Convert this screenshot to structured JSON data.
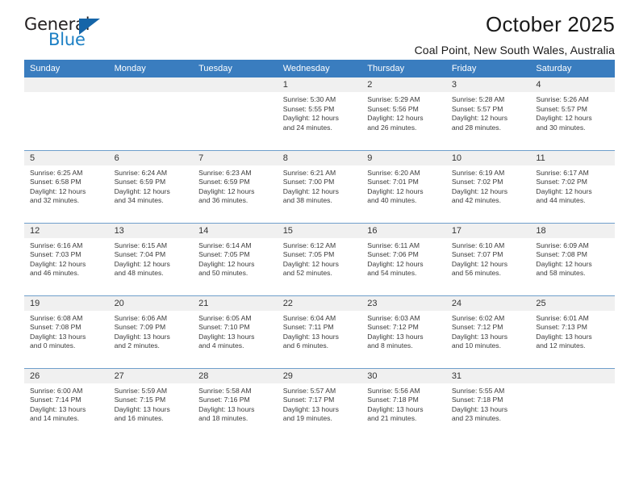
{
  "brand": {
    "word_one": "General",
    "word_two": "Blue",
    "triangle_color": "#1565a8",
    "blue_color": "#1b7fc4"
  },
  "header": {
    "month_title": "October 2025",
    "location": "Coal Point, New South Wales, Australia",
    "header_bg": "#3a7dbf"
  },
  "weekday_headers": [
    "Sunday",
    "Monday",
    "Tuesday",
    "Wednesday",
    "Thursday",
    "Friday",
    "Saturday"
  ],
  "labels": {
    "sunrise_prefix": "Sunrise:",
    "sunset_prefix": "Sunset:",
    "daylight_prefix": "Daylight:"
  },
  "weeks": [
    [
      {
        "day": "",
        "empty": true
      },
      {
        "day": "",
        "empty": true
      },
      {
        "day": "",
        "empty": true
      },
      {
        "day": "1",
        "sunrise": "Sunrise: 5:30 AM",
        "sunset": "Sunset: 5:55 PM",
        "daylight_1": "Daylight: 12 hours",
        "daylight_2": "and 24 minutes."
      },
      {
        "day": "2",
        "sunrise": "Sunrise: 5:29 AM",
        "sunset": "Sunset: 5:56 PM",
        "daylight_1": "Daylight: 12 hours",
        "daylight_2": "and 26 minutes."
      },
      {
        "day": "3",
        "sunrise": "Sunrise: 5:28 AM",
        "sunset": "Sunset: 5:57 PM",
        "daylight_1": "Daylight: 12 hours",
        "daylight_2": "and 28 minutes."
      },
      {
        "day": "4",
        "sunrise": "Sunrise: 5:26 AM",
        "sunset": "Sunset: 5:57 PM",
        "daylight_1": "Daylight: 12 hours",
        "daylight_2": "and 30 minutes."
      }
    ],
    [
      {
        "day": "5",
        "sunrise": "Sunrise: 6:25 AM",
        "sunset": "Sunset: 6:58 PM",
        "daylight_1": "Daylight: 12 hours",
        "daylight_2": "and 32 minutes."
      },
      {
        "day": "6",
        "sunrise": "Sunrise: 6:24 AM",
        "sunset": "Sunset: 6:59 PM",
        "daylight_1": "Daylight: 12 hours",
        "daylight_2": "and 34 minutes."
      },
      {
        "day": "7",
        "sunrise": "Sunrise: 6:23 AM",
        "sunset": "Sunset: 6:59 PM",
        "daylight_1": "Daylight: 12 hours",
        "daylight_2": "and 36 minutes."
      },
      {
        "day": "8",
        "sunrise": "Sunrise: 6:21 AM",
        "sunset": "Sunset: 7:00 PM",
        "daylight_1": "Daylight: 12 hours",
        "daylight_2": "and 38 minutes."
      },
      {
        "day": "9",
        "sunrise": "Sunrise: 6:20 AM",
        "sunset": "Sunset: 7:01 PM",
        "daylight_1": "Daylight: 12 hours",
        "daylight_2": "and 40 minutes."
      },
      {
        "day": "10",
        "sunrise": "Sunrise: 6:19 AM",
        "sunset": "Sunset: 7:02 PM",
        "daylight_1": "Daylight: 12 hours",
        "daylight_2": "and 42 minutes."
      },
      {
        "day": "11",
        "sunrise": "Sunrise: 6:17 AM",
        "sunset": "Sunset: 7:02 PM",
        "daylight_1": "Daylight: 12 hours",
        "daylight_2": "and 44 minutes."
      }
    ],
    [
      {
        "day": "12",
        "sunrise": "Sunrise: 6:16 AM",
        "sunset": "Sunset: 7:03 PM",
        "daylight_1": "Daylight: 12 hours",
        "daylight_2": "and 46 minutes."
      },
      {
        "day": "13",
        "sunrise": "Sunrise: 6:15 AM",
        "sunset": "Sunset: 7:04 PM",
        "daylight_1": "Daylight: 12 hours",
        "daylight_2": "and 48 minutes."
      },
      {
        "day": "14",
        "sunrise": "Sunrise: 6:14 AM",
        "sunset": "Sunset: 7:05 PM",
        "daylight_1": "Daylight: 12 hours",
        "daylight_2": "and 50 minutes."
      },
      {
        "day": "15",
        "sunrise": "Sunrise: 6:12 AM",
        "sunset": "Sunset: 7:05 PM",
        "daylight_1": "Daylight: 12 hours",
        "daylight_2": "and 52 minutes."
      },
      {
        "day": "16",
        "sunrise": "Sunrise: 6:11 AM",
        "sunset": "Sunset: 7:06 PM",
        "daylight_1": "Daylight: 12 hours",
        "daylight_2": "and 54 minutes."
      },
      {
        "day": "17",
        "sunrise": "Sunrise: 6:10 AM",
        "sunset": "Sunset: 7:07 PM",
        "daylight_1": "Daylight: 12 hours",
        "daylight_2": "and 56 minutes."
      },
      {
        "day": "18",
        "sunrise": "Sunrise: 6:09 AM",
        "sunset": "Sunset: 7:08 PM",
        "daylight_1": "Daylight: 12 hours",
        "daylight_2": "and 58 minutes."
      }
    ],
    [
      {
        "day": "19",
        "sunrise": "Sunrise: 6:08 AM",
        "sunset": "Sunset: 7:08 PM",
        "daylight_1": "Daylight: 13 hours",
        "daylight_2": "and 0 minutes."
      },
      {
        "day": "20",
        "sunrise": "Sunrise: 6:06 AM",
        "sunset": "Sunset: 7:09 PM",
        "daylight_1": "Daylight: 13 hours",
        "daylight_2": "and 2 minutes."
      },
      {
        "day": "21",
        "sunrise": "Sunrise: 6:05 AM",
        "sunset": "Sunset: 7:10 PM",
        "daylight_1": "Daylight: 13 hours",
        "daylight_2": "and 4 minutes."
      },
      {
        "day": "22",
        "sunrise": "Sunrise: 6:04 AM",
        "sunset": "Sunset: 7:11 PM",
        "daylight_1": "Daylight: 13 hours",
        "daylight_2": "and 6 minutes."
      },
      {
        "day": "23",
        "sunrise": "Sunrise: 6:03 AM",
        "sunset": "Sunset: 7:12 PM",
        "daylight_1": "Daylight: 13 hours",
        "daylight_2": "and 8 minutes."
      },
      {
        "day": "24",
        "sunrise": "Sunrise: 6:02 AM",
        "sunset": "Sunset: 7:12 PM",
        "daylight_1": "Daylight: 13 hours",
        "daylight_2": "and 10 minutes."
      },
      {
        "day": "25",
        "sunrise": "Sunrise: 6:01 AM",
        "sunset": "Sunset: 7:13 PM",
        "daylight_1": "Daylight: 13 hours",
        "daylight_2": "and 12 minutes."
      }
    ],
    [
      {
        "day": "26",
        "sunrise": "Sunrise: 6:00 AM",
        "sunset": "Sunset: 7:14 PM",
        "daylight_1": "Daylight: 13 hours",
        "daylight_2": "and 14 minutes."
      },
      {
        "day": "27",
        "sunrise": "Sunrise: 5:59 AM",
        "sunset": "Sunset: 7:15 PM",
        "daylight_1": "Daylight: 13 hours",
        "daylight_2": "and 16 minutes."
      },
      {
        "day": "28",
        "sunrise": "Sunrise: 5:58 AM",
        "sunset": "Sunset: 7:16 PM",
        "daylight_1": "Daylight: 13 hours",
        "daylight_2": "and 18 minutes."
      },
      {
        "day": "29",
        "sunrise": "Sunrise: 5:57 AM",
        "sunset": "Sunset: 7:17 PM",
        "daylight_1": "Daylight: 13 hours",
        "daylight_2": "and 19 minutes."
      },
      {
        "day": "30",
        "sunrise": "Sunrise: 5:56 AM",
        "sunset": "Sunset: 7:18 PM",
        "daylight_1": "Daylight: 13 hours",
        "daylight_2": "and 21 minutes."
      },
      {
        "day": "31",
        "sunrise": "Sunrise: 5:55 AM",
        "sunset": "Sunset: 7:18 PM",
        "daylight_1": "Daylight: 13 hours",
        "daylight_2": "and 23 minutes."
      },
      {
        "day": "",
        "empty": true
      }
    ]
  ]
}
